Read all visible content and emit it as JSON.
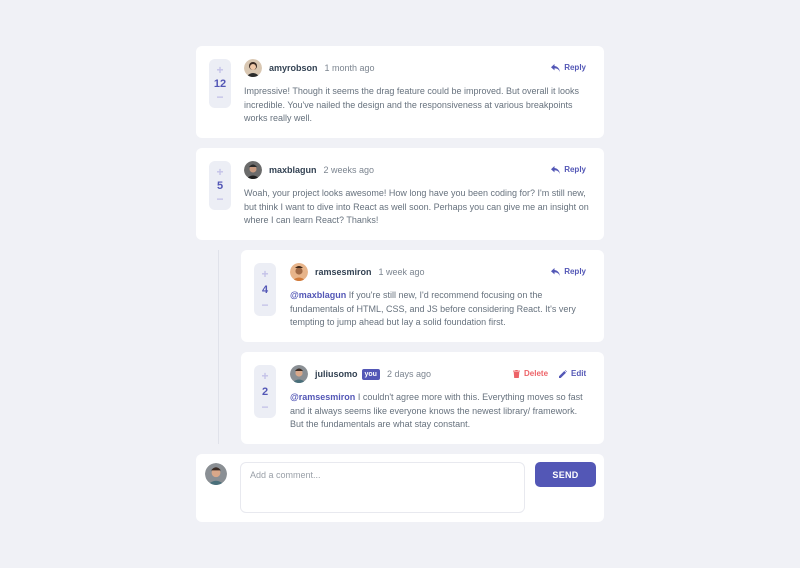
{
  "colors": {
    "background": "#f0f1f6",
    "card": "#ffffff",
    "accent": "#5357b6",
    "danger": "#ed6368",
    "username": "#334253",
    "text": "#67727e"
  },
  "comments": [
    {
      "username": "amyrobson",
      "time": "1 month ago",
      "score": "12",
      "action_label": "Reply",
      "mention": "",
      "text": "Impressive! Though it seems the drag feature could be improved. But overall it looks incredible. You've nailed the design and the responsiveness at various breakpoints works really well."
    },
    {
      "username": "maxblagun",
      "time": "2 weeks ago",
      "score": "5",
      "action_label": "Reply",
      "mention": "",
      "text": "Woah, your project looks awesome! How long have you been coding for? I'm still new, but think I want to dive into React as well soon. Perhaps you can give me an insight on where I can learn React? Thanks!"
    }
  ],
  "replies": [
    {
      "username": "ramsesmiron",
      "time": "1 week ago",
      "score": "4",
      "action_label": "Reply",
      "mention": "@maxblagun",
      "text": " If you're still new, I'd recommend focusing on the fundamentals of HTML, CSS, and JS before considering React. It's very tempting to jump ahead but lay a solid foundation first."
    },
    {
      "username": "juliusomo",
      "badge": "you",
      "time": "2 days ago",
      "score": "2",
      "delete_label": "Delete",
      "edit_label": "Edit",
      "mention": "@ramsesmiron",
      "text": " I couldn't agree more with this. Everything moves so fast and it always seems like everyone knows the newest library/ framework. But the fundamentals are what stay constant."
    }
  ],
  "vote": {
    "up": "+",
    "down": "−"
  },
  "new_comment": {
    "placeholder": "Add a comment...",
    "send_label": "SEND"
  },
  "icons": {
    "reply": "reply-icon",
    "delete": "trash-icon",
    "edit": "pencil-icon"
  }
}
